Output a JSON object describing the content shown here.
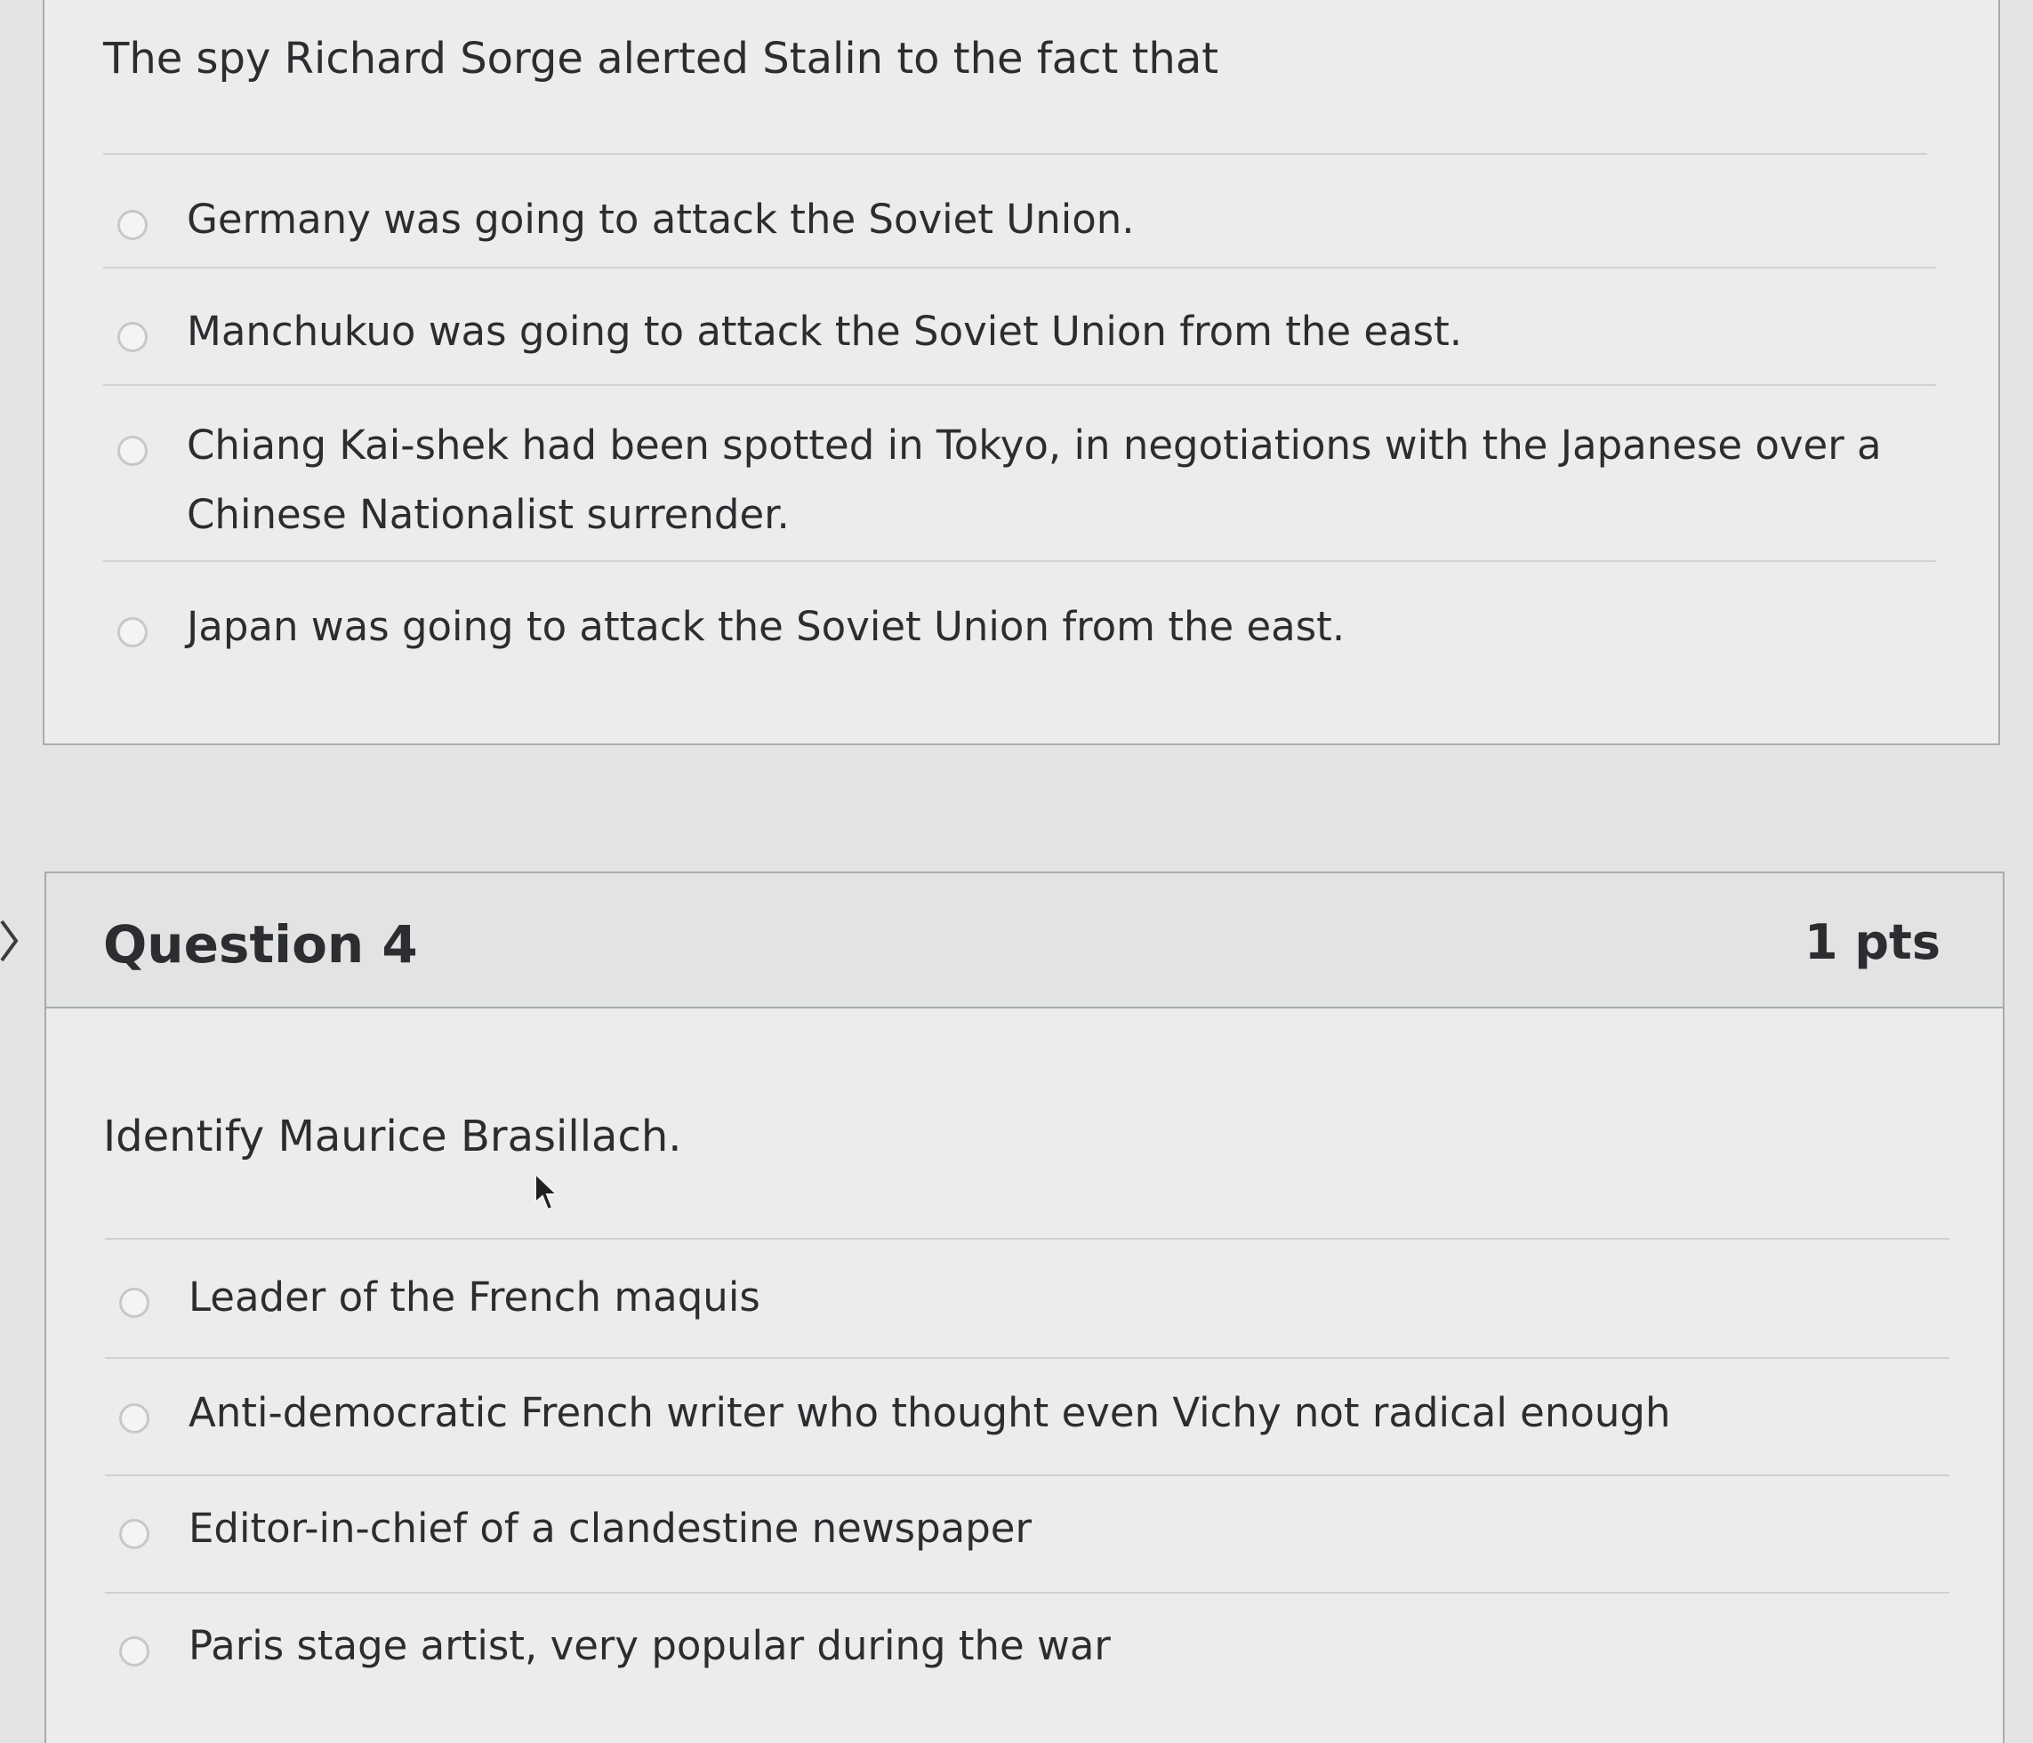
{
  "question3": {
    "text": "The spy Richard Sorge alerted Stalin to the fact that",
    "answers": [
      "Germany was going to attack the Soviet Union.",
      "Manchukuo was going to attack the Soviet Union from the east.",
      "Chiang Kai-shek had been spotted in Tokyo, in negotiations with the Japanese over a Chinese Nationalist surrender.",
      "Japan was going to attack the Soviet Union from the east."
    ]
  },
  "question4": {
    "title": "Question 4",
    "points": "1 pts",
    "text": "Identify Maurice Brasillach.",
    "answers": [
      "Leader of the French maquis",
      "Anti-democratic French writer who thought even Vichy not radical enough",
      "Editor-in-chief of a clandestine newspaper",
      "Paris stage artist, very popular during the war"
    ]
  },
  "icons": {
    "collapse": "chevron-right-icon",
    "pointer": "mouse-cursor-icon"
  }
}
